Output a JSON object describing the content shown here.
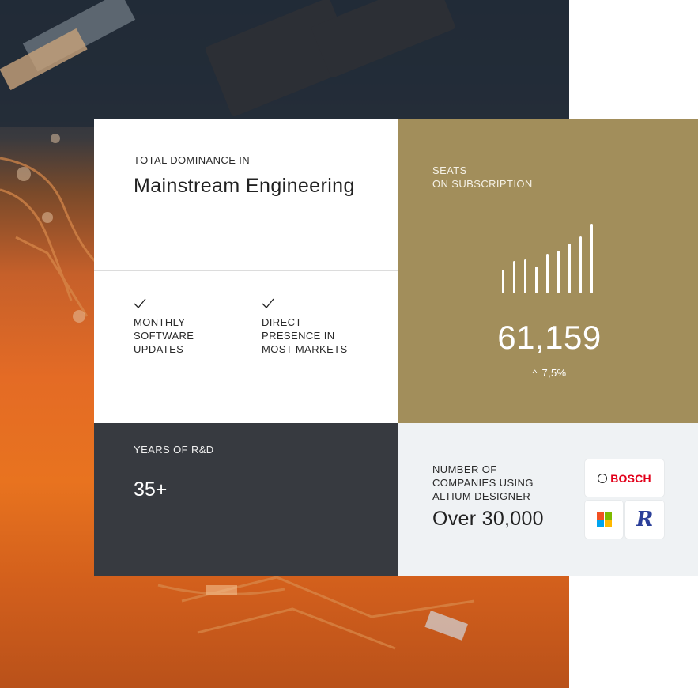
{
  "main": {
    "kicker": "TOTAL DOMINANCE IN",
    "headline": "Mainstream Engineering",
    "features": [
      {
        "label": "MONTHLY\nSOFTWARE\nUPDATES",
        "icon": "check-icon"
      },
      {
        "label": "DIRECT\nPRESENCE IN\nMOST MARKETS",
        "icon": "check-icon"
      }
    ]
  },
  "seats": {
    "kicker": "SEATS\nON SUBSCRIPTION",
    "value": "61,159",
    "delta": "7,5%",
    "delta_icon": "up-chevron-icon",
    "bar_levels": [
      0.33,
      0.45,
      0.48,
      0.38,
      0.55,
      0.6,
      0.7,
      0.8,
      0.98
    ]
  },
  "rd": {
    "kicker": "YEARS OF R&D",
    "value": "35+"
  },
  "companies": {
    "kicker": "NUMBER OF\nCOMPANIES USING\nALTIUM DESIGNER",
    "value": "Over 30,000",
    "logos": {
      "bosch": "BOSCH",
      "r": "R"
    }
  },
  "colors": {
    "seats_bg": "#a28e5b",
    "rd_bg": "#373a40",
    "companies_bg": "#eff2f4",
    "bosch_red": "#e2001a"
  }
}
